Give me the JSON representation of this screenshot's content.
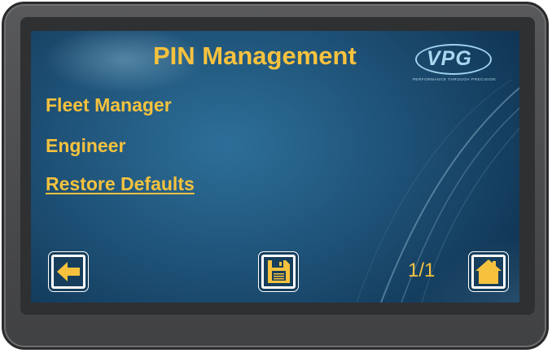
{
  "screen": {
    "title": "PIN Management",
    "logo_text": "VPG",
    "logo_tagline": "PERFORMANCE THROUGH PRECISION"
  },
  "menu": {
    "items": [
      {
        "label": "Fleet Manager"
      },
      {
        "label": "Engineer"
      },
      {
        "label": "Restore Defaults"
      }
    ]
  },
  "footer": {
    "page_indicator": "1/1",
    "back_icon": "arrow-left-icon",
    "save_icon": "floppy-disk-icon",
    "home_icon": "home-icon"
  },
  "colors": {
    "accent": "#f6c23e",
    "screen_bg": "#1d4f74",
    "bezel": "#4a4b4d"
  }
}
